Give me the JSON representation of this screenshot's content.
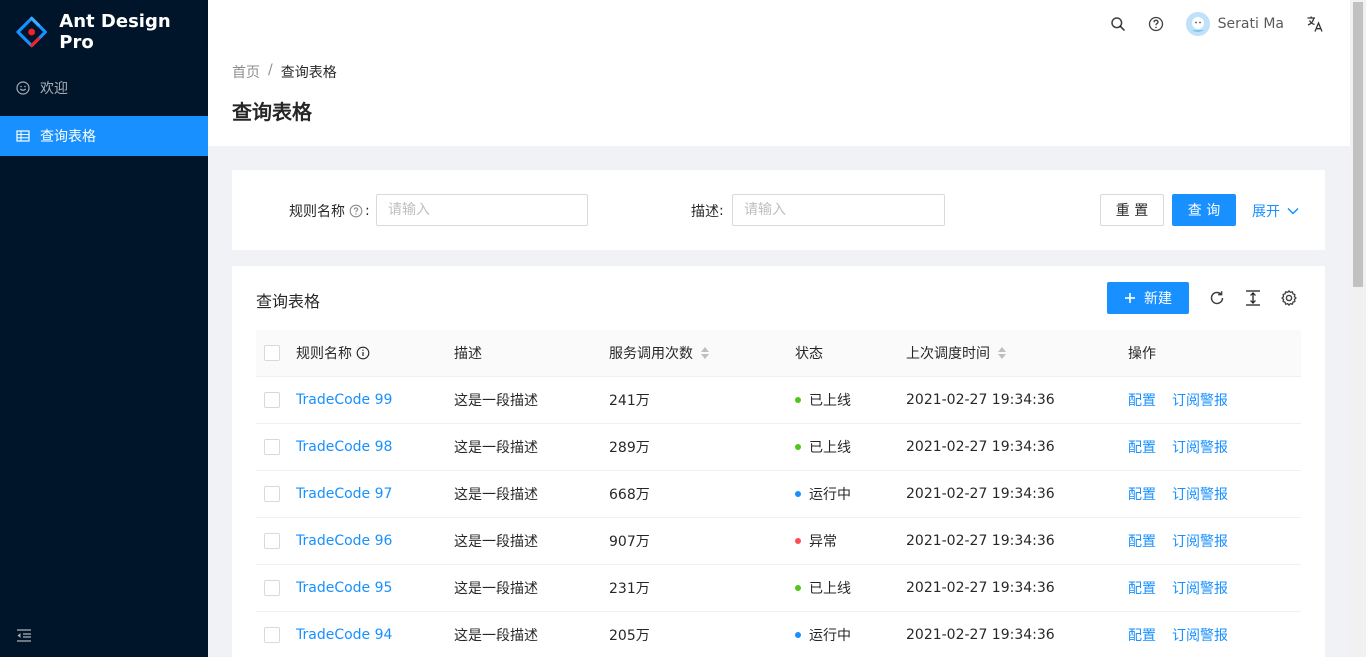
{
  "app": {
    "title": "Ant Design Pro"
  },
  "sidebar": {
    "items": [
      {
        "label": "欢迎",
        "icon": "smile-icon",
        "active": false
      },
      {
        "label": "查询表格",
        "icon": "table-icon",
        "active": true
      }
    ]
  },
  "header": {
    "user_name": "Serati Ma"
  },
  "breadcrumb": {
    "home": "首页",
    "separator": "/",
    "current": "查询表格"
  },
  "page": {
    "title": "查询表格"
  },
  "search": {
    "rule_name_label": "规则名称",
    "rule_name_placeholder": "请输入",
    "desc_label": "描述",
    "desc_placeholder": "请输入",
    "colon": ":",
    "reset_label": "重 置",
    "query_label": "查 询",
    "expand_label": "展开"
  },
  "table": {
    "title": "查询表格",
    "new_label": "新建",
    "columns": [
      "规则名称",
      "描述",
      "服务调用次数",
      "状态",
      "上次调度时间",
      "操作"
    ],
    "action_config": "配置",
    "action_subscribe": "订阅警报",
    "rows": [
      {
        "name": "TradeCode 99",
        "desc": "这是一段描述",
        "calls": "241万",
        "status": "已上线",
        "status_color": "#52c41a",
        "time": "2021-02-27 19:34:36"
      },
      {
        "name": "TradeCode 98",
        "desc": "这是一段描述",
        "calls": "289万",
        "status": "已上线",
        "status_color": "#52c41a",
        "time": "2021-02-27 19:34:36"
      },
      {
        "name": "TradeCode 97",
        "desc": "这是一段描述",
        "calls": "668万",
        "status": "运行中",
        "status_color": "#1890ff",
        "time": "2021-02-27 19:34:36"
      },
      {
        "name": "TradeCode 96",
        "desc": "这是一段描述",
        "calls": "907万",
        "status": "异常",
        "status_color": "#ff4d4f",
        "time": "2021-02-27 19:34:36"
      },
      {
        "name": "TradeCode 95",
        "desc": "这是一段描述",
        "calls": "231万",
        "status": "已上线",
        "status_color": "#52c41a",
        "time": "2021-02-27 19:34:36"
      },
      {
        "name": "TradeCode 94",
        "desc": "这是一段描述",
        "calls": "205万",
        "status": "运行中",
        "status_color": "#1890ff",
        "time": "2021-02-27 19:34:36"
      }
    ]
  },
  "colors": {
    "primary": "#1890ff",
    "sider": "#001529"
  }
}
